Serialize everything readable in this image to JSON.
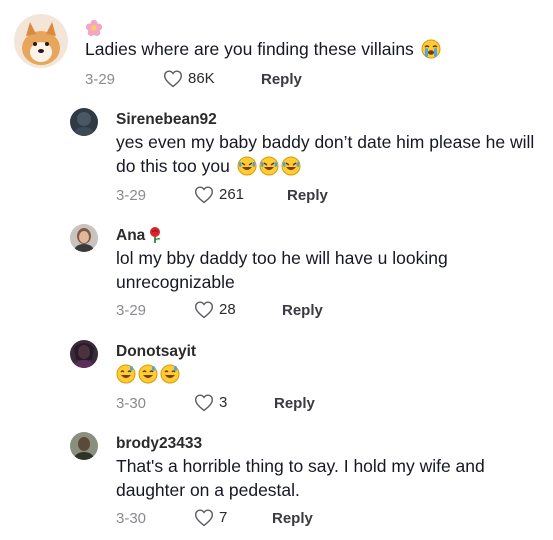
{
  "comments": [
    {
      "username": "",
      "badge_icon": "flower-icon",
      "text": "Ladies where are you finding these villains",
      "text_emoji": [
        "loudly-crying-face-icon"
      ],
      "date": "3-29",
      "likes": "86K",
      "reply_label": "Reply"
    },
    {
      "username": "Sirenebean92",
      "text": "yes even my baby baddy don’t date him please he will do this too you",
      "text_emoji": [
        "rolling-laughing-face-icon",
        "rolling-laughing-face-icon",
        "rolling-laughing-face-icon"
      ],
      "date": "3-29",
      "likes": "261",
      "reply_label": "Reply"
    },
    {
      "username": "Ana",
      "badge_icon": "rose-icon",
      "text": "lol my bby daddy too he will have u looking unrecognizable",
      "date": "3-29",
      "likes": "28",
      "reply_label": "Reply"
    },
    {
      "username": "Donotsayit",
      "text": "",
      "text_emoji": [
        "grinning-sweat-face-icon",
        "grinning-sweat-face-icon",
        "grinning-sweat-face-icon"
      ],
      "date": "3-30",
      "likes": "3",
      "reply_label": "Reply"
    },
    {
      "username": "brody23433",
      "text": "That's a horrible thing to say. I hold my wife and daughter on a pedestal.",
      "date": "3-30",
      "likes": "7",
      "reply_label": "Reply"
    }
  ]
}
